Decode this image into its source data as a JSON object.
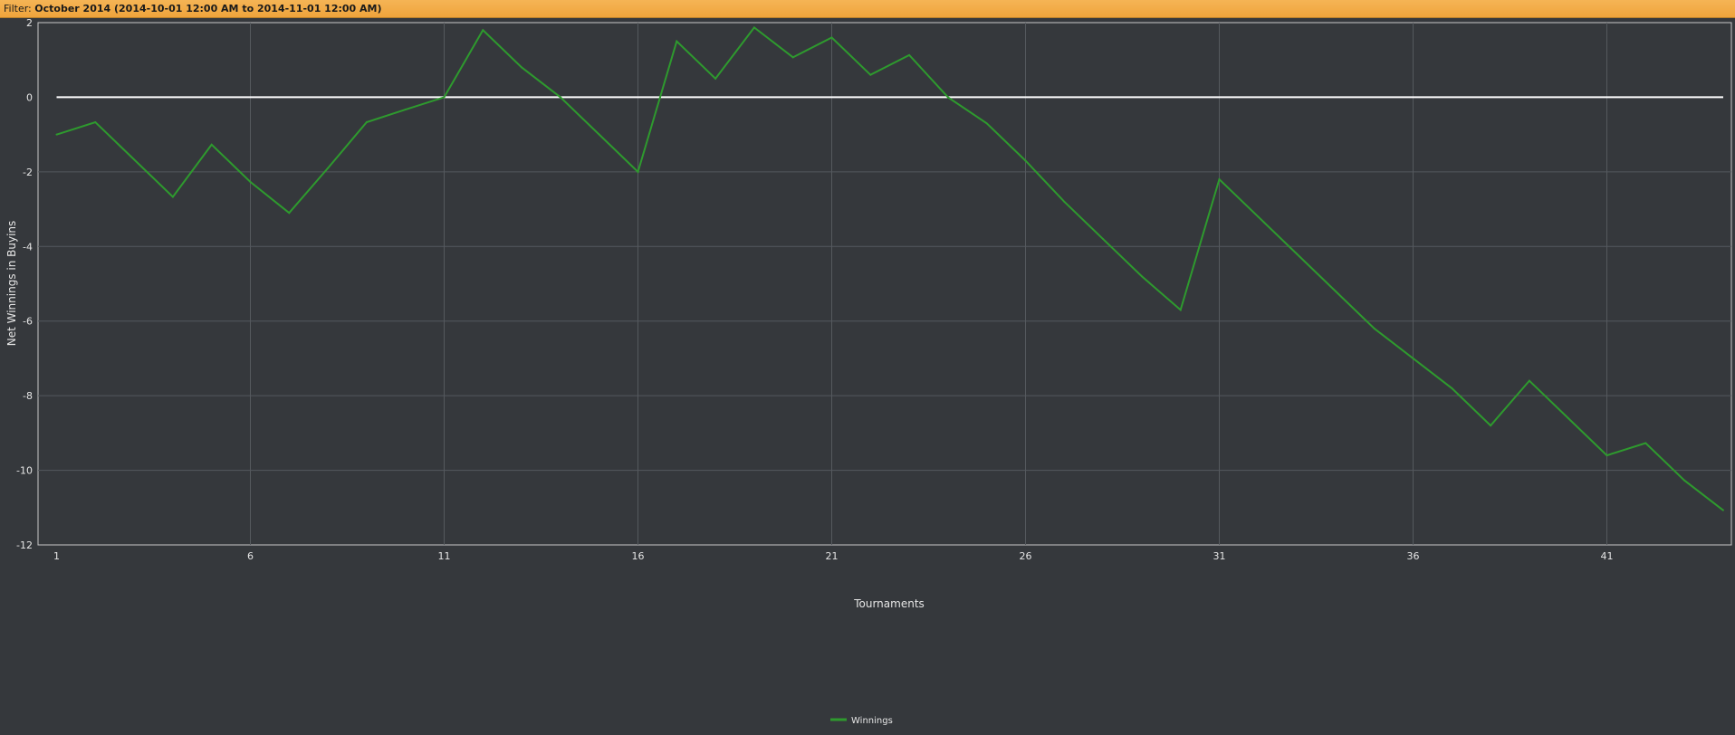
{
  "filter": {
    "label": "Filter:",
    "value": "October 2014 (2014-10-01 12:00 AM to 2014-11-01 12:00 AM)"
  },
  "colors": {
    "background": "#35383c",
    "filter_bar": "#efa43c",
    "series": "#2e9a2e",
    "zero_line": "#ffffff",
    "grid": "#55595e",
    "axis": "#c9c9c9",
    "text": "#e6e6e6"
  },
  "chart_data": {
    "type": "line",
    "title": "",
    "xlabel": "Tournaments",
    "ylabel": "Net Winnings in Buyins",
    "xlim": [
      1,
      44.3
    ],
    "ylim": [
      -12,
      2
    ],
    "xticks": [
      1,
      6,
      11,
      16,
      21,
      26,
      31,
      36,
      41
    ],
    "yticks": [
      2,
      0,
      -2,
      -4,
      -6,
      -8,
      -10,
      -12
    ],
    "grid": true,
    "zero_line": true,
    "legend_position": "bottom-center",
    "series": [
      {
        "name": "Winnings",
        "x": [
          1,
          2,
          3,
          4,
          5,
          6,
          7,
          8,
          9,
          10,
          11,
          12,
          13,
          14,
          15,
          16,
          17,
          18,
          19,
          20,
          21,
          22,
          23,
          24,
          25,
          26,
          27,
          28,
          29,
          30,
          31,
          32,
          33,
          34,
          35,
          36,
          37,
          38,
          39,
          40,
          41,
          42,
          43,
          44
        ],
        "values": [
          -1.0,
          -0.67,
          -1.67,
          -2.67,
          -1.27,
          -2.27,
          -3.1,
          -1.9,
          -0.67,
          -0.33,
          0.0,
          1.8,
          0.8,
          0.0,
          -1.0,
          -2.0,
          1.5,
          0.5,
          1.87,
          1.07,
          1.6,
          0.6,
          1.13,
          0.0,
          -0.7,
          -1.7,
          -2.8,
          -3.8,
          -4.8,
          -5.7,
          -2.2,
          -3.2,
          -4.2,
          -5.2,
          -6.2,
          -7.0,
          -7.8,
          -8.8,
          -7.6,
          -8.6,
          -9.6,
          -9.27,
          -10.27,
          -11.07
        ]
      }
    ]
  }
}
